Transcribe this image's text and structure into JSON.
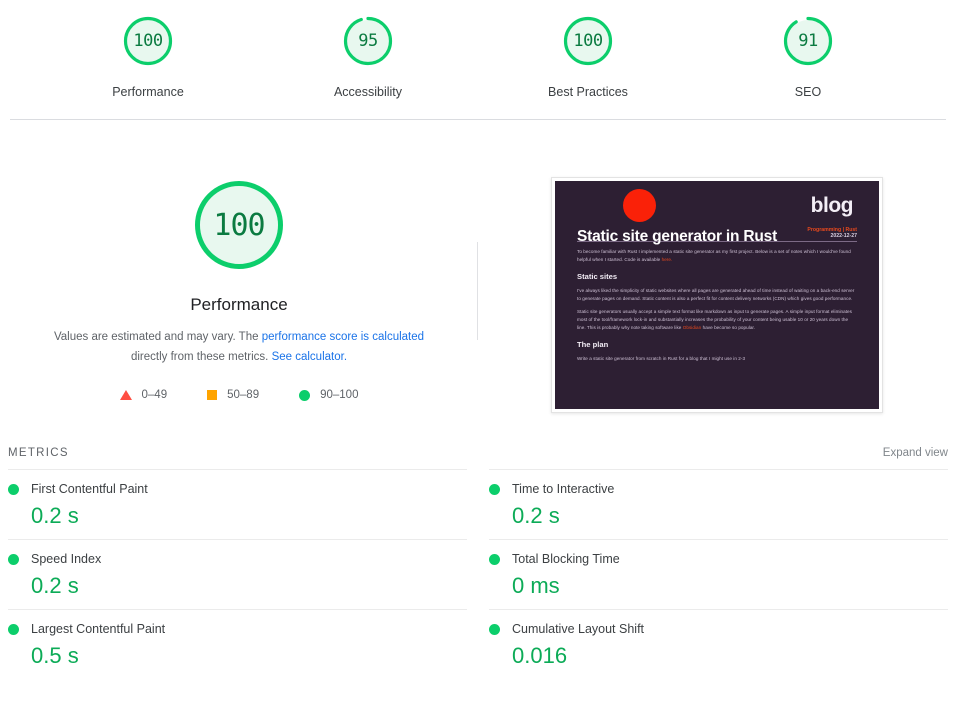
{
  "top_scores": [
    {
      "label": "Performance",
      "score": "100",
      "value": 100,
      "color": "#0cce6b"
    },
    {
      "label": "Accessibility",
      "score": "95",
      "value": 95,
      "color": "#0cce6b"
    },
    {
      "label": "Best Practices",
      "score": "100",
      "value": 100,
      "color": "#0cce6b"
    },
    {
      "label": "SEO",
      "score": "91",
      "value": 91,
      "color": "#0cce6b"
    }
  ],
  "hero": {
    "score": "100",
    "score_value": 100,
    "title": "Performance",
    "desc_lead": "Values are estimated and may vary. The ",
    "desc_link1": "performance score is calculated",
    "desc_mid": "directly from these metrics. ",
    "desc_link2": "See calculator.",
    "legend": [
      {
        "icon": "triangle-icon",
        "range": "0–49",
        "color": "#ff4e42"
      },
      {
        "icon": "square-icon",
        "range": "50–89",
        "color": "#ffa400"
      },
      {
        "icon": "circle-icon",
        "range": "90–100",
        "color": "#0cce6b"
      }
    ]
  },
  "thumbnail": {
    "brand": "blog",
    "heading": "Static site generator in Rust",
    "tag": "Programming | Rust",
    "date": "2022-12-27",
    "intro": "To become familiar with Rust I implemented a static site generator as my first project. Below is a set of notes which I would've found helpful when I started. Code is available ",
    "intro_link": "here.",
    "section1_title": "Static sites",
    "section1_p1": "I've always liked the simplicity of static websites where all pages are generated ahead of time instead of waiting on a back-end server to generate pages on demand. Static content is also a perfect fit for content delivery networks (CDN) which gives good performance.",
    "section1_p2a": "Static site generators usually accept a simple text format like markdown as input to generate pages. A simple input format eliminates most of the tool/framework lock-in and substantially increases the probability of your content being usable 10 or 20 years down the line. This is probably why note taking software like ",
    "section1_p2_link": "Obsidian",
    "section1_p2b": " have become so popular.",
    "section2_title": "The plan",
    "section2_p1": "Write a static site generator from scratch in Rust for a blog that I might use in 2-3"
  },
  "metrics": {
    "section_label": "METRICS",
    "expand_label": "Expand view",
    "left": [
      {
        "name": "First Contentful Paint",
        "value": "0.2 s",
        "status": "pass"
      },
      {
        "name": "Speed Index",
        "value": "0.2 s",
        "status": "pass"
      },
      {
        "name": "Largest Contentful Paint",
        "value": "0.5 s",
        "status": "pass"
      }
    ],
    "right": [
      {
        "name": "Time to Interactive",
        "value": "0.2 s",
        "status": "pass"
      },
      {
        "name": "Total Blocking Time",
        "value": "0 ms",
        "status": "pass"
      },
      {
        "name": "Cumulative Layout Shift",
        "value": "0.016",
        "status": "pass"
      }
    ]
  }
}
